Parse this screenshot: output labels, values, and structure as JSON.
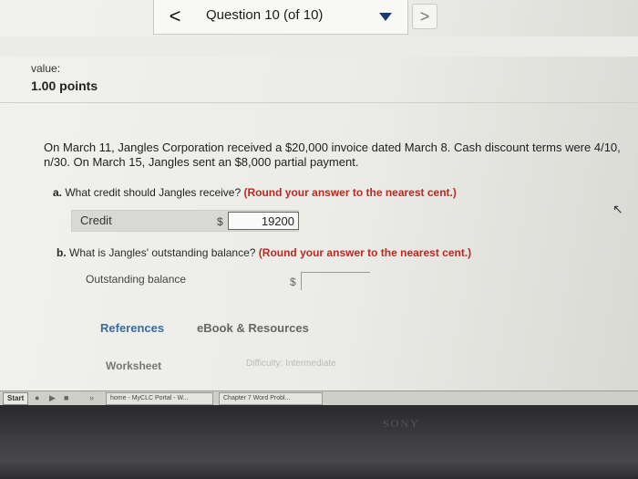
{
  "question_nav": {
    "prev_label": "<",
    "title": "Question 10 (of 10)",
    "next_label": ">"
  },
  "score": {
    "label": "value:",
    "points": "1.00 points"
  },
  "problem": {
    "text": "On March 11, Jangles Corporation received a $20,000 invoice dated March 8. Cash discount terms were 4/10, n/30. On March 15, Jangles sent an $8,000 partial payment."
  },
  "part_a": {
    "letter": "a.",
    "question": "What credit should Jangles receive?",
    "hint": "(Round your answer to the nearest cent.)",
    "field_label": "Credit",
    "currency": "$",
    "value": "19200"
  },
  "part_b": {
    "letter": "b.",
    "question": "What is Jangles' outstanding balance?",
    "hint": "(Round your answer to the nearest cent.)",
    "field_label": "Outstanding balance",
    "currency": "$",
    "value": ""
  },
  "resources": {
    "references": "References",
    "ebook": "eBook & Resources",
    "worksheet": "Worksheet",
    "difficulty": "Difficulty: Intermediate"
  },
  "taskbar": {
    "start": "Start",
    "items": [
      "home - MyCLC Portal - W...",
      "Chapter 7 Word Probl..."
    ]
  },
  "device": {
    "brand": "SONY"
  },
  "colors": {
    "hint_red": "#c0271f",
    "link_blue": "#3a6aa0",
    "dropdown_navy": "#1c3a6e"
  }
}
